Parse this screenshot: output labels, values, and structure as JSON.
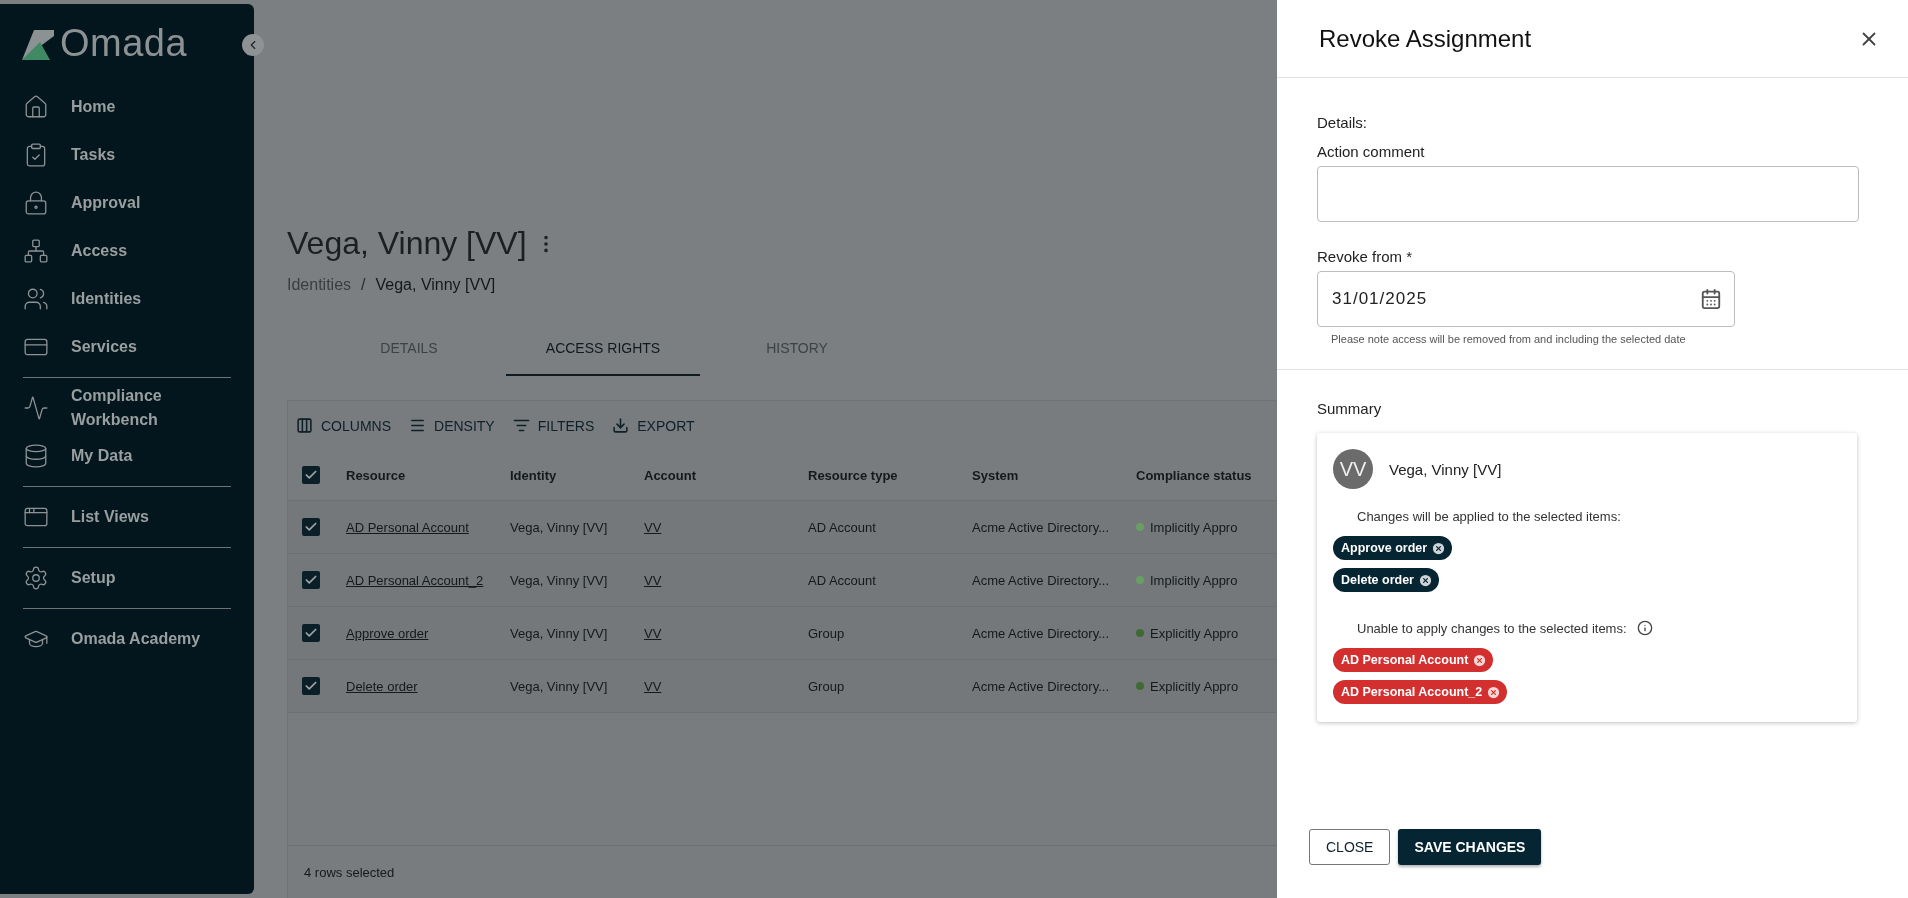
{
  "sidebar": {
    "logo": "Omada",
    "groups": [
      [
        {
          "label": "Home"
        },
        {
          "label": "Tasks"
        },
        {
          "label": "Approval"
        },
        {
          "label": "Access"
        },
        {
          "label": "Identities"
        },
        {
          "label": "Services"
        }
      ],
      [
        {
          "label": "Compliance Workbench"
        },
        {
          "label": "My Data"
        }
      ],
      [
        {
          "label": "List Views"
        }
      ],
      [
        {
          "label": "Setup"
        }
      ],
      [
        {
          "label": "Omada Academy"
        }
      ]
    ]
  },
  "page": {
    "title": "Vega, Vinny [VV]",
    "breadcrumb": {
      "separator": "/",
      "items": [
        "Identities",
        "Vega, Vinny [VV]"
      ]
    },
    "tabs": [
      {
        "label": "DETAILS",
        "selected": false
      },
      {
        "label": "ACCESS RIGHTS",
        "selected": true
      },
      {
        "label": "HISTORY",
        "selected": false
      }
    ],
    "toolbar": [
      "COLUMNS",
      "DENSITY",
      "FILTERS",
      "EXPORT"
    ],
    "table": {
      "all_checked": true,
      "columns": [
        "Resource",
        "Identity",
        "Account",
        "Resource type",
        "System",
        "Compliance status"
      ],
      "rows": [
        {
          "checked": true,
          "resource": "AD Personal Account",
          "identity": "Vega, Vinny [VV]",
          "account": "VV",
          "type": "AD Account",
          "system": "Acme Active Directory...",
          "status": "Implicitly Appro",
          "color": "#6a9f64"
        },
        {
          "checked": true,
          "resource": "AD Personal Account_2",
          "identity": "Vega, Vinny [VV]",
          "account": "VV",
          "type": "AD Account",
          "system": "Acme Active Directory...",
          "status": "Implicitly Appro",
          "color": "#6a9f64"
        },
        {
          "checked": true,
          "resource": "Approve order",
          "identity": "Vega, Vinny [VV]",
          "account": "VV",
          "type": "Group",
          "system": "Acme Active Directory...",
          "status": "Explicitly Appro",
          "color": "#3e6b34"
        },
        {
          "checked": true,
          "resource": "Delete order",
          "identity": "Vega, Vinny [VV]",
          "account": "VV",
          "type": "Group",
          "system": "Acme Active Directory...",
          "status": "Explicitly Appro",
          "color": "#3e6b34"
        }
      ],
      "footer": "4 rows selected"
    }
  },
  "drawer": {
    "title": "Revoke Assignment",
    "details_label": "Details:",
    "comment": {
      "label": "Action comment"
    },
    "revoke_from": {
      "label": "Revoke from *",
      "value": "31/01/2025",
      "helper": "Please note access will be removed from and including the selected date"
    },
    "summary": {
      "label": "Summary",
      "initials": "VV",
      "name": "Vega, Vinny [VV]",
      "sections": [
        {
          "kind": "applied",
          "text": "Changes will be applied to the selected items:",
          "items": [
            "Approve order",
            "Delete order"
          ]
        },
        {
          "kind": "unable",
          "text": "Unable to apply changes to the selected items:",
          "items": [
            "AD Personal Account",
            "AD Personal Account_2"
          ]
        }
      ]
    },
    "buttons": [
      {
        "kind": "outline",
        "label": "CLOSE"
      },
      {
        "kind": "primary",
        "label": "SAVE CHANGES"
      }
    ]
  }
}
